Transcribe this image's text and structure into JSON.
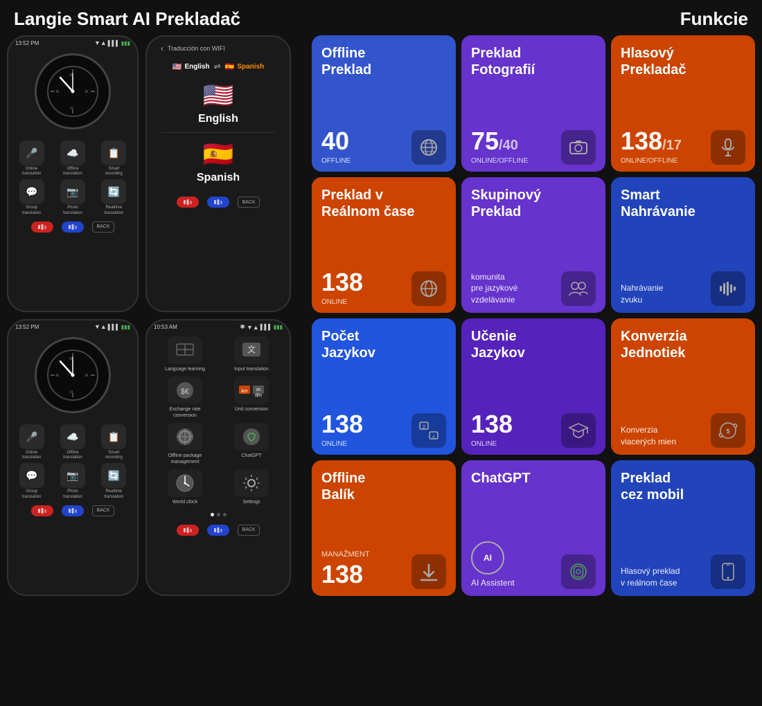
{
  "header": {
    "title": "Langie Smart AI Prekladač",
    "funkcie": "Funkcie"
  },
  "phone1_top": {
    "time": "13:52 PM"
  },
  "phone1_icons": [
    {
      "icon": "🎤",
      "label": "Online\ntranslation"
    },
    {
      "icon": "☁️",
      "label": "Offline\ntranslation"
    },
    {
      "icon": "📋",
      "label": "Smart\nrecording"
    },
    {
      "icon": "💬",
      "label": "Group\ntranslation"
    },
    {
      "icon": "📷",
      "label": "Photo\ntranslation"
    },
    {
      "icon": "🔄",
      "label": "Realtime\ntranslation"
    }
  ],
  "phone2_top": {
    "back": "‹",
    "title": "Traducción con WIFI"
  },
  "phone2_langs": {
    "from_flag": "🇺🇸",
    "from_name": "English",
    "to_flag": "🇪🇸",
    "to_name": "Spanish"
  },
  "phone3_top": {
    "time": "13:52 PM"
  },
  "phone4_top": {
    "time": "10:53 AM"
  },
  "phone4_items": [
    {
      "icon": "📚",
      "label": "Language learning"
    },
    {
      "icon": "🔤",
      "label": "Input translation"
    },
    {
      "icon": "💱",
      "label": "Exchange rate\nconversion"
    },
    {
      "icon": "📏",
      "label": "Unit conversion"
    },
    {
      "icon": "📦",
      "label": "Offline package\nmanagement"
    },
    {
      "icon": "🤖",
      "label": "ChatGPT"
    },
    {
      "icon": "🕐",
      "label": "World clock"
    },
    {
      "icon": "⚙️",
      "label": "Settings"
    }
  ],
  "cards": [
    {
      "id": "offline-preklad",
      "color": "card-blue",
      "title": "Offline\nPreklad",
      "number": "40",
      "number_suffix": "",
      "label": "OFFLINE",
      "icon": "🌐"
    },
    {
      "id": "preklad-fotografii",
      "color": "card-purple",
      "title": "Preklad\nFotografií",
      "number": "75",
      "number_suffix": "/40",
      "label": "ONLINE/OFFLINE",
      "icon": "📷"
    },
    {
      "id": "hlasovy-prekladac",
      "color": "card-orange",
      "title": "Hlasový\nPrekladač",
      "number": "138",
      "number_suffix": "/17",
      "label": "ONLINE/OFFLINE",
      "icon": "🎤"
    },
    {
      "id": "preklad-realnom-case",
      "color": "card-orange",
      "title": "Preklad v\nReálnom čase",
      "number": "138",
      "number_suffix": "",
      "label": "ONLINE",
      "icon": "🌐"
    },
    {
      "id": "skupinovy-preklad",
      "color": "card-purple",
      "title": "Skupinový\nPreklad",
      "desc": "komunita\npre jazykové\nvzdelávanie",
      "icon": "👥"
    },
    {
      "id": "smart-nahravanie",
      "color": "card-blue2",
      "title": "Smart\nNahrávanie",
      "desc": "Nahrávanie\nzvuku",
      "icon": "📊"
    },
    {
      "id": "pocet-jazykov",
      "color": "card-blue3",
      "title": "Počet\nJazykov",
      "number": "138",
      "number_suffix": "",
      "label": "ONLINE",
      "icon": "🔤"
    },
    {
      "id": "ucenie-jazykov",
      "color": "card-purple2",
      "title": "Učenie\nJazykov",
      "number": "138",
      "number_suffix": "",
      "label": "ONLINE",
      "icon": "🎓"
    },
    {
      "id": "konverzia-jednotiek",
      "color": "card-orange",
      "title": "Konverzia\nJednotiek",
      "desc": "Konverzia\nviacerých mien",
      "icon": "💱"
    },
    {
      "id": "offline-balik",
      "color": "card-orange",
      "title": "Offline\nBalík",
      "number": "138",
      "number_suffix": "",
      "label": "MANAŽMENT",
      "icon": "⬇️"
    },
    {
      "id": "chatgpt",
      "color": "card-purple",
      "title": "ChatGPT",
      "desc": "AI Assistent",
      "icon": "🤖"
    },
    {
      "id": "preklad-cez-mobil",
      "color": "card-blue2",
      "title": "Preklad\ncez mobil",
      "desc": "Hlasový preklad\nv reálnom čase",
      "icon": "📱"
    }
  ],
  "chatgpt_logo": "AI"
}
